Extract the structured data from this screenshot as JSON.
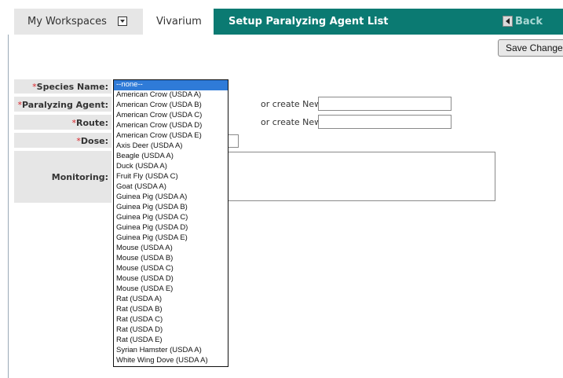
{
  "nav": {
    "workspaces_label": "My Workspaces",
    "workspace_tab_label": "Vivarium",
    "page_title": "Setup Paralyzing Agent List",
    "back_label": "Back"
  },
  "toolbar": {
    "save_label": "Save Changes"
  },
  "form": {
    "species_label": "Species Name:",
    "agent_label": "Paralyzing Agent:",
    "route_label": "Route:",
    "dose_label": "Dose:",
    "monitoring_label": "Monitoring:",
    "required_marker": "*",
    "create_new_agent": "or create New",
    "create_new_route": "or create New",
    "agent_new_value": "",
    "route_new_value": "",
    "dose_value": "",
    "monitoring_value": ""
  },
  "species_options": [
    "--none--",
    "American Crow (USDA A)",
    "American Crow (USDA B)",
    "American Crow (USDA C)",
    "American Crow (USDA D)",
    "American Crow (USDA E)",
    "Axis Deer (USDA A)",
    "Beagle (USDA A)",
    "Duck (USDA A)",
    "Fruit Fly (USDA C)",
    "Goat (USDA A)",
    "Guinea Pig (USDA A)",
    "Guinea Pig (USDA B)",
    "Guinea Pig (USDA C)",
    "Guinea Pig (USDA D)",
    "Guinea Pig (USDA E)",
    "Mouse (USDA A)",
    "Mouse (USDA B)",
    "Mouse (USDA C)",
    "Mouse (USDA D)",
    "Mouse (USDA E)",
    "Rat (USDA A)",
    "Rat (USDA B)",
    "Rat (USDA C)",
    "Rat (USDA D)",
    "Rat (USDA E)",
    "Syrian Hamster (USDA A)",
    "White Wing Dove (USDA A)"
  ],
  "selected_species": "--none--",
  "colors": {
    "accent": "#0b7a72",
    "required": "#d9262c",
    "selection": "#2f7bd8"
  }
}
